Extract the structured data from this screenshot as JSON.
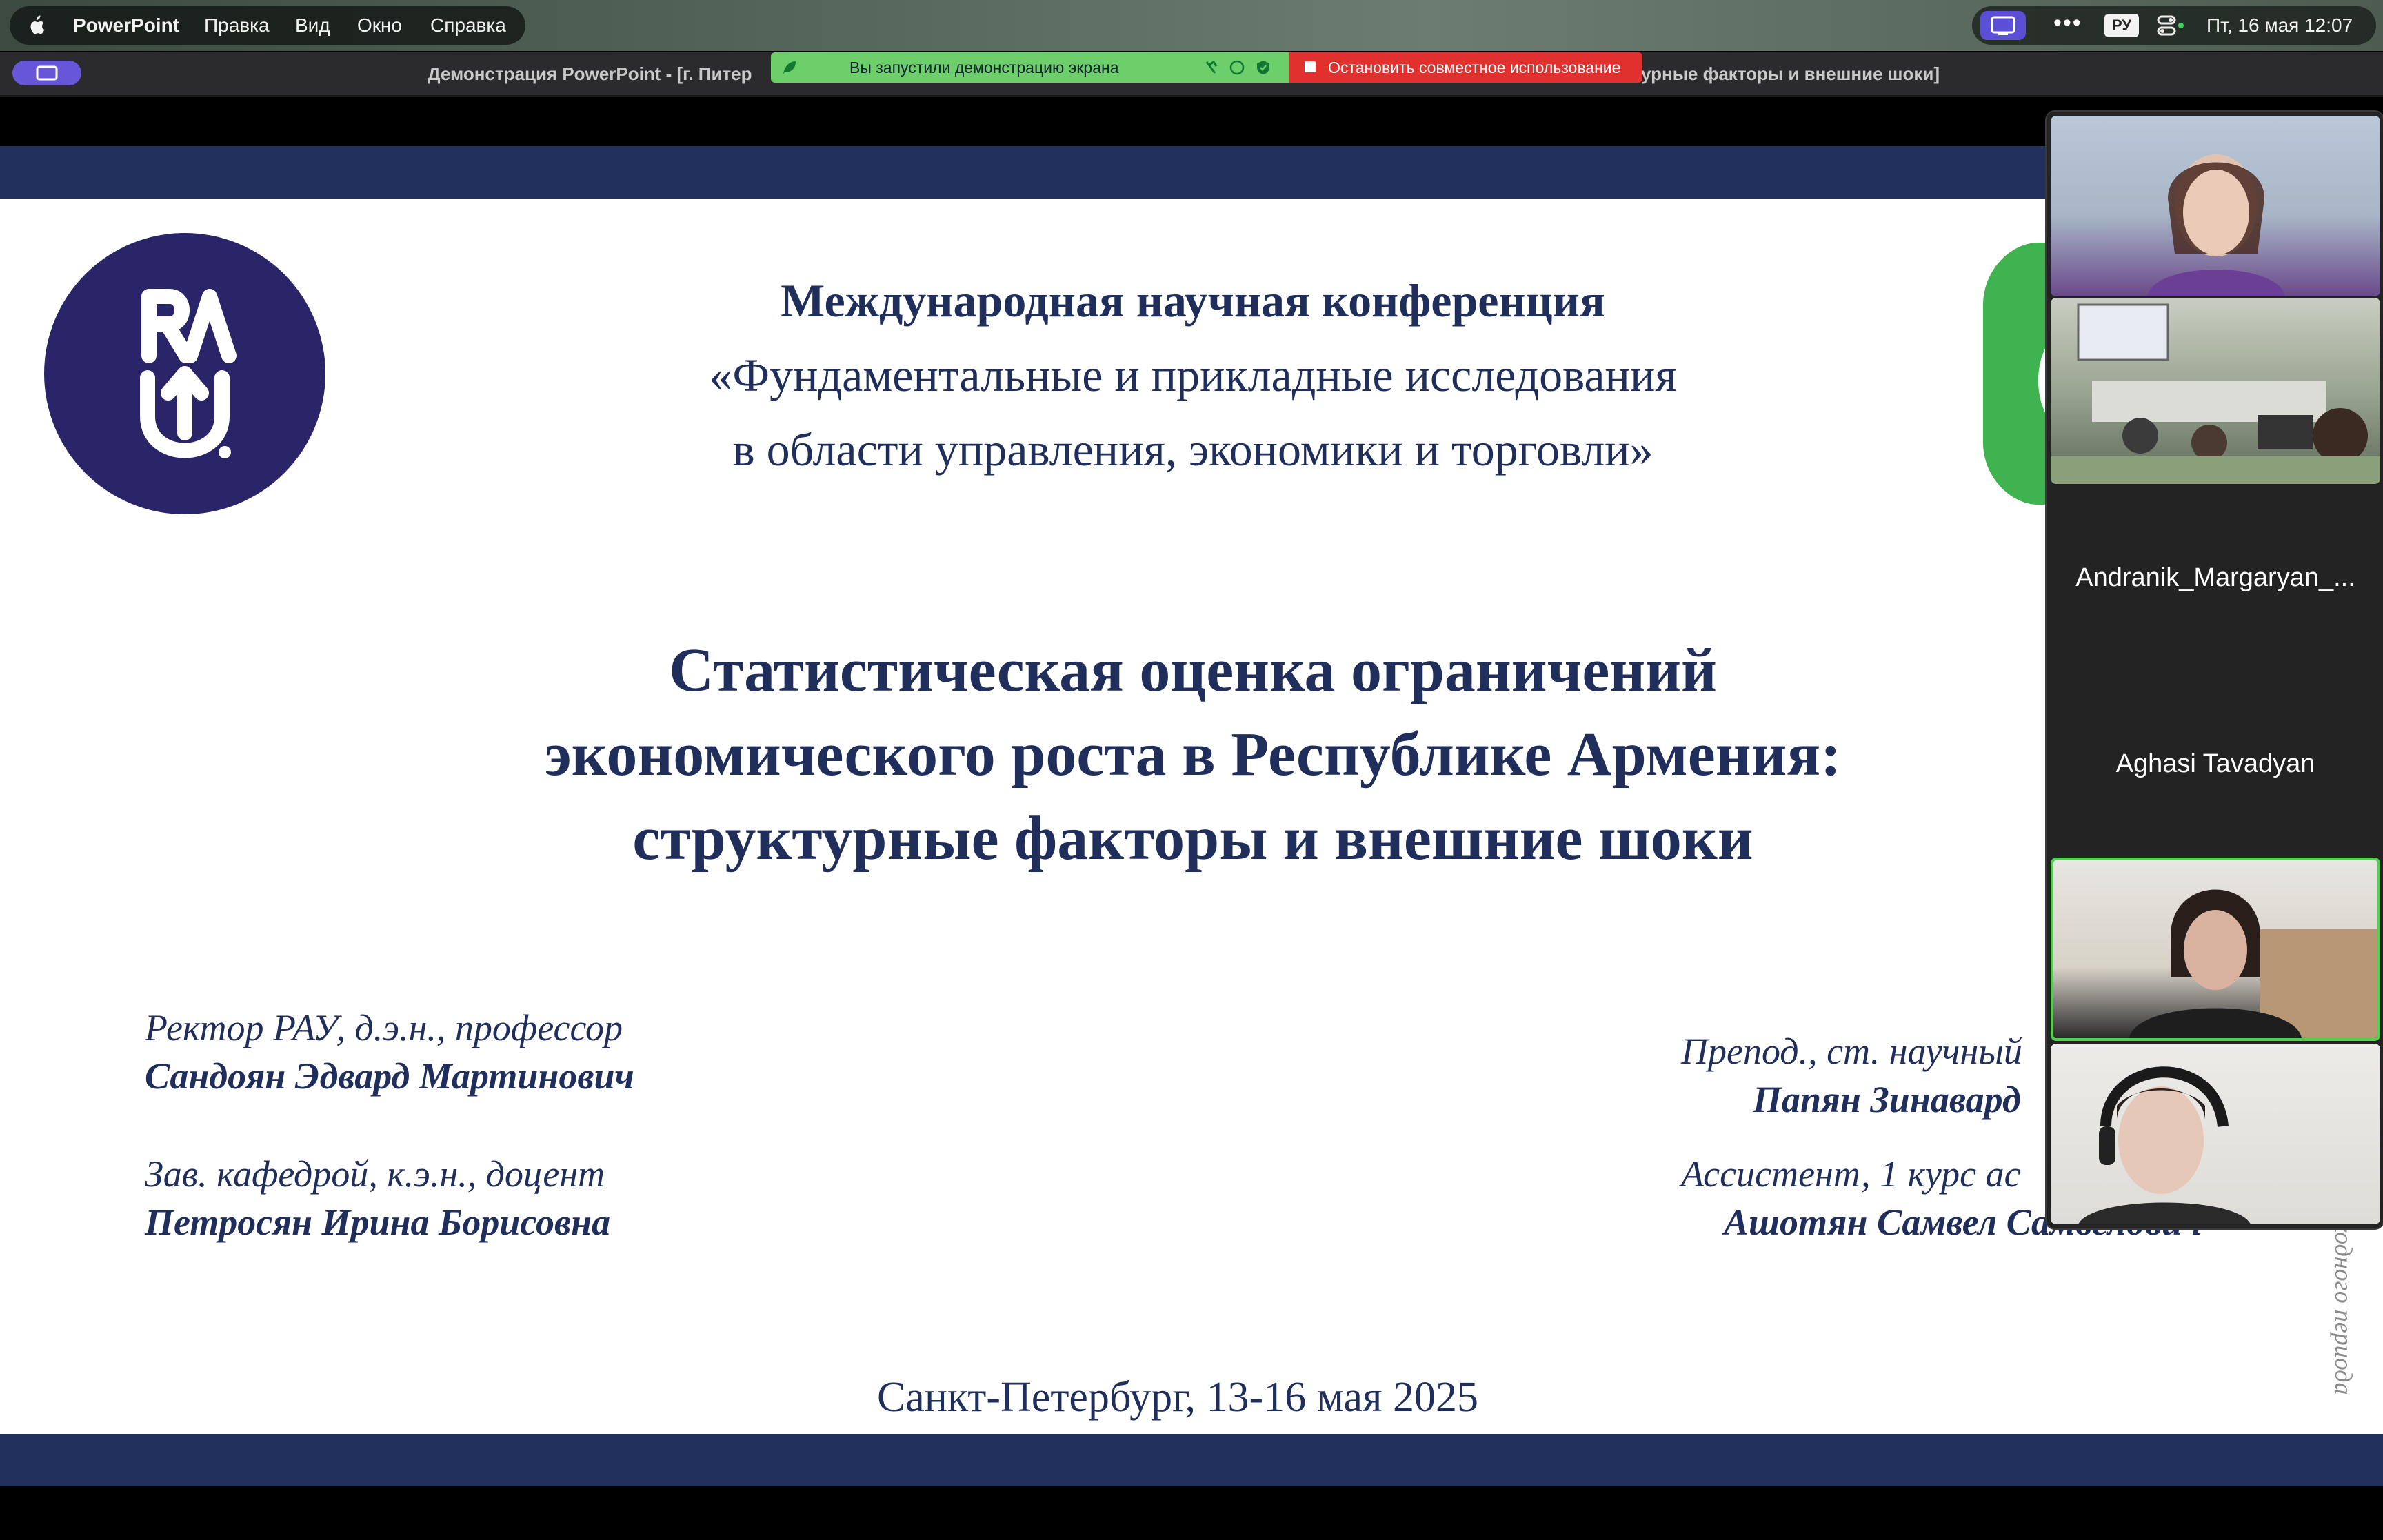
{
  "menubar": {
    "app_name": "PowerPoint",
    "items": [
      "Правка",
      "Вид",
      "Окно",
      "Справка"
    ],
    "lang": "РУ",
    "clock": "Пт, 16 мая  12:07"
  },
  "window": {
    "title_left": "Демонстрация PowerPoint - [г. Питер",
    "title_right": "урные факторы и внешние шоки]"
  },
  "share_banner": {
    "status": "Вы запустили демонстрацию экрана",
    "stop_label": "Остановить совместное использование",
    "green": "#6ccf6a",
    "red": "#e0312f"
  },
  "slide": {
    "conference": {
      "line1": "Международная научная конференция",
      "line2": "«Фундаментальные и прикладные исследования",
      "line3": "в области управления, экономики и торговли»"
    },
    "title": {
      "line1": "Статистическая оценка ограничений",
      "line2": "экономического роста в Республике Армения:",
      "line3": "структурные факторы и внешние шоки"
    },
    "authors_left": [
      {
        "role": "Ректор РАУ, д.э.н., профессор",
        "name": "Сандоян Эдвард Мартинович"
      },
      {
        "role": "Зав. кафедрой, к.э.н., доцент",
        "name": "Петросян Ирина Борисовна"
      }
    ],
    "authors_right": [
      {
        "role": "Препод., ст. научный",
        "name": "Папян Зинавард"
      },
      {
        "role": "Ассистент, 1 курс ас",
        "name": "Ашотян Самвел Самвелович"
      }
    ],
    "vertical_note": "ходного периода",
    "place_date": "Санкт-Петербург, 13-16 мая 2025",
    "band_color": "#22305e",
    "text_color": "#1f2e5a"
  },
  "participants": {
    "names": [
      "Andranik_Margaryan_...",
      "Aghasi Tavadyan"
    ],
    "active_color": "#4fd14b"
  }
}
